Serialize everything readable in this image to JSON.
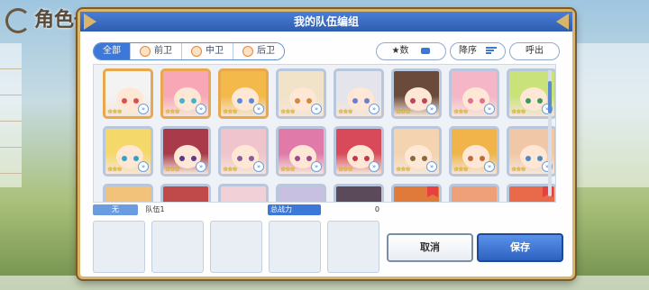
{
  "background": {
    "title": "角色一览"
  },
  "dialog": {
    "title": "我的队伍编组",
    "tabs": [
      {
        "label": "全部",
        "active": true
      },
      {
        "label": "前卫",
        "active": false
      },
      {
        "label": "中卫",
        "active": false
      },
      {
        "label": "后卫",
        "active": false
      }
    ],
    "sort_field": "★数",
    "sort_order": "降序",
    "call_out": "呼出",
    "team_badge": "无",
    "team_name": "队伍1",
    "power_label": "总战力",
    "power_value": "0",
    "cancel_label": "取消",
    "save_label": "保存"
  },
  "characters": [
    {
      "stars": "★★★",
      "hair": "#f3f3f3",
      "eyes": "#d85050",
      "frame": "gold"
    },
    {
      "stars": "★★★",
      "hair": "#f7a7b5",
      "eyes": "#4ab0c9",
      "frame": "gold"
    },
    {
      "stars": "★★★",
      "hair": "#f3b94a",
      "eyes": "#5a8ad6",
      "frame": "gold"
    },
    {
      "stars": "★★★",
      "hair": "#f0e3c8",
      "eyes": "#d08a40",
      "frame": "silver"
    },
    {
      "stars": "★★★",
      "hair": "#e4e4ec",
      "eyes": "#6a7fd0",
      "frame": "silver"
    },
    {
      "stars": "★★★",
      "hair": "#6a4a3a",
      "eyes": "#c04060",
      "frame": "silver"
    },
    {
      "stars": "★★★",
      "hair": "#f5b6c8",
      "eyes": "#e07090",
      "frame": "silver"
    },
    {
      "stars": "★★★",
      "hair": "#c9e27a",
      "eyes": "#3a9a5a",
      "frame": "silver"
    },
    {
      "stars": "★★★",
      "hair": "#f5d86a",
      "eyes": "#3aa0c0",
      "frame": "silver"
    },
    {
      "stars": "★★★",
      "hair": "#a83a4a",
      "eyes": "#5a3a8a",
      "frame": "silver"
    },
    {
      "stars": "★★★",
      "hair": "#f0c4cc",
      "eyes": "#8a5a9a",
      "frame": "silver"
    },
    {
      "stars": "★★★",
      "hair": "#e07aa8",
      "eyes": "#a04a8a",
      "frame": "silver"
    },
    {
      "stars": "★★★",
      "hair": "#d84a5a",
      "eyes": "#c03a4a",
      "frame": "silver"
    },
    {
      "stars": "★★★",
      "hair": "#f3d3b0",
      "eyes": "#8a6a3a",
      "frame": "silver"
    },
    {
      "stars": "★★★",
      "hair": "#f0b44a",
      "eyes": "#c06a3a",
      "frame": "silver"
    },
    {
      "stars": "★★★",
      "hair": "#f0c8a8",
      "eyes": "#4a8ac0",
      "frame": "silver"
    },
    {
      "stars": "",
      "hair": "#f3c27a",
      "eyes": "#d08a40",
      "frame": "silver"
    },
    {
      "stars": "",
      "hair": "#c04a4a",
      "eyes": "#8a3a3a",
      "frame": "silver"
    },
    {
      "stars": "",
      "hair": "#f2d0d8",
      "eyes": "#c06a8a",
      "frame": "silver"
    },
    {
      "stars": "",
      "hair": "#c8c0e0",
      "eyes": "#6a5aa0",
      "frame": "silver"
    },
    {
      "stars": "",
      "hair": "#5a4a5a",
      "eyes": "#3a2a4a",
      "frame": "silver"
    },
    {
      "stars": "",
      "hair": "#e07a3a",
      "eyes": "#c04a2a",
      "frame": "silver"
    },
    {
      "stars": "",
      "hair": "#f0a078",
      "eyes": "#c06040",
      "frame": "silver"
    },
    {
      "stars": "",
      "hair": "#e86a4a",
      "eyes": "#b04a3a",
      "frame": "silver"
    }
  ],
  "flagged_cards": [
    21,
    23
  ]
}
